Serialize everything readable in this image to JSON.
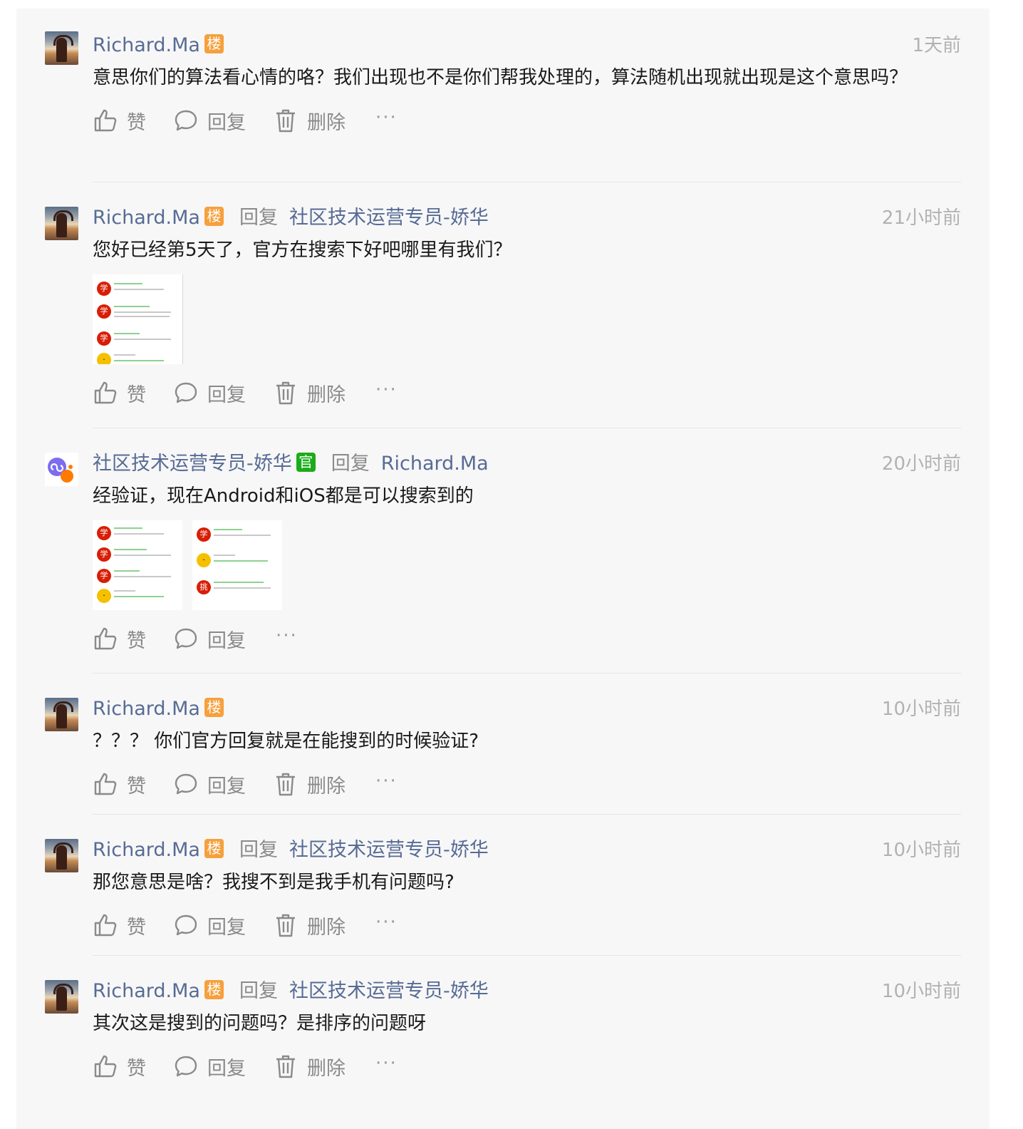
{
  "actions": {
    "like": "赞",
    "reply": "回复",
    "delete": "删除",
    "more": "···"
  },
  "reply_word": "回复",
  "comments": [
    {
      "author": "Richard.Ma",
      "badge": "楼",
      "reply_to": "",
      "time": "1天前",
      "text": "意思你们的算法看心情的咯？我们出现也不是你们帮我处理的，算法随机出现就出现是这个意思吗？",
      "has_delete": true
    },
    {
      "author": "Richard.Ma",
      "badge": "楼",
      "reply_to": "社区技术运营专员-娇华",
      "time": "21小时前",
      "text": "您好已经第5天了，官方在搜索下好吧哪里有我们？",
      "has_delete": true,
      "images": 1
    },
    {
      "author": "社区技术运营专员-娇华",
      "badge": "官",
      "reply_to": "Richard.Ma",
      "time": "20小时前",
      "text": "经验证，现在Android和iOS都是可以搜索到的",
      "has_delete": false,
      "images": 2
    },
    {
      "author": "Richard.Ma",
      "badge": "楼",
      "reply_to": "",
      "time": "10小时前",
      "text": "？？？ 你们官方回复就是在能搜到的时候验证?",
      "has_delete": true
    },
    {
      "author": "Richard.Ma",
      "badge": "楼",
      "reply_to": "社区技术运营专员-娇华",
      "time": "10小时前",
      "text": "那您意思是啥？我搜不到是我手机有问题吗?",
      "has_delete": true
    },
    {
      "author": "Richard.Ma",
      "badge": "楼",
      "reply_to": "社区技术运营专员-娇华",
      "time": "10小时前",
      "text": "其次这是搜到的问题吗？是排序的问题呀",
      "has_delete": true
    }
  ],
  "colors": {
    "link": "#576b95",
    "badge_lou": "#f6a03d",
    "badge_guan": "#1aad19",
    "meta": "#b2b2b2"
  }
}
